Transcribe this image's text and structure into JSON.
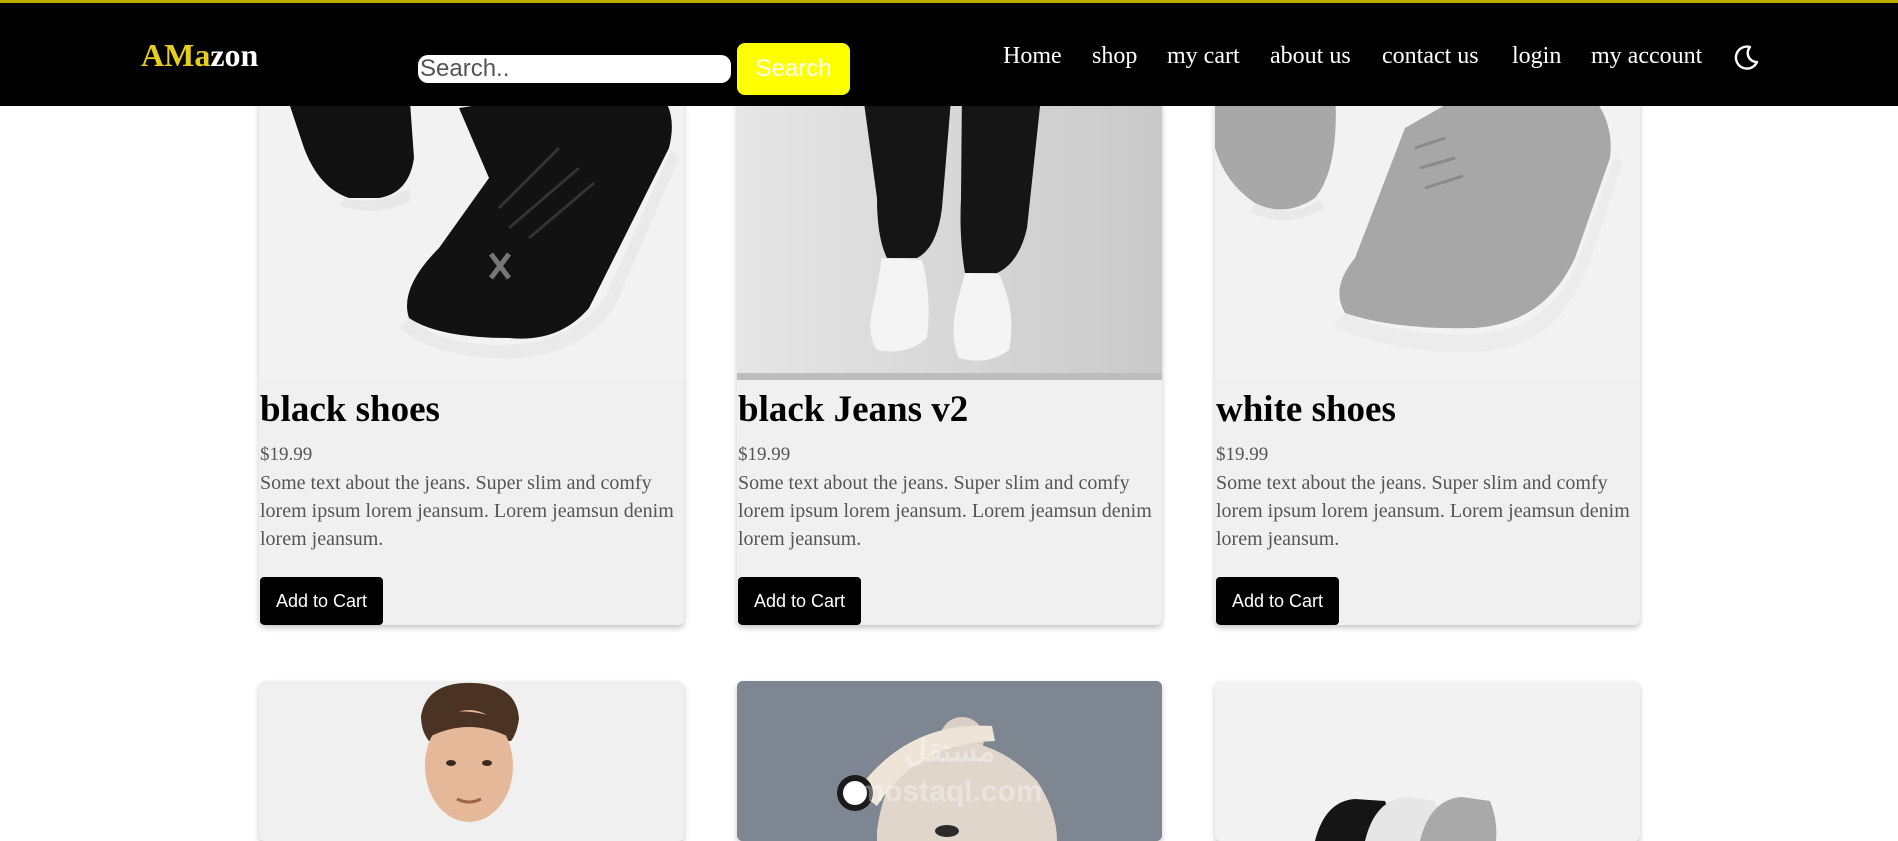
{
  "header": {
    "logo_a": "A",
    "logo_m": "M",
    "logo_a2": "a",
    "logo_rest": "zon",
    "search_placeholder": "Search..",
    "search_button": "Search",
    "nav": [
      "Home",
      "shop",
      "my cart",
      "about us",
      "contact us",
      "login",
      "my account"
    ],
    "theme_icon": "moon-icon"
  },
  "products": [
    {
      "name": "black shoes",
      "price": "$19.99",
      "description": "Some text about the jeans. Super slim and comfy lorem ipsum lorem jeansum. Lorem jeamsun denim lorem jeansum.",
      "button": "Add to Cart",
      "image": "black-sneakers-photo"
    },
    {
      "name": "black Jeans v2",
      "price": "$19.99",
      "description": "Some text about the jeans. Super slim and comfy lorem ipsum lorem jeansum. Lorem jeamsun denim lorem jeansum.",
      "button": "Add to Cart",
      "image": "black-jeans-photo"
    },
    {
      "name": "white shoes",
      "price": "$19.99",
      "description": "Some text about the jeans. Super slim and comfy lorem ipsum lorem jeansum. Lorem jeamsun denim lorem jeansum.",
      "button": "Add to Cart",
      "image": "grey-sneakers-photo"
    }
  ],
  "second_row_images": [
    "man-portrait-photo",
    "woman-smartwatch-photo",
    "sneaker-trio-photo"
  ],
  "watermark_lines": [
    "مستقل",
    "mostaql.com"
  ],
  "colors": {
    "header_bg": "#000000",
    "accent_yellow": "#ffff00",
    "logo_yellow": "#e6cf1a",
    "card_bg": "#f0f0f0"
  }
}
